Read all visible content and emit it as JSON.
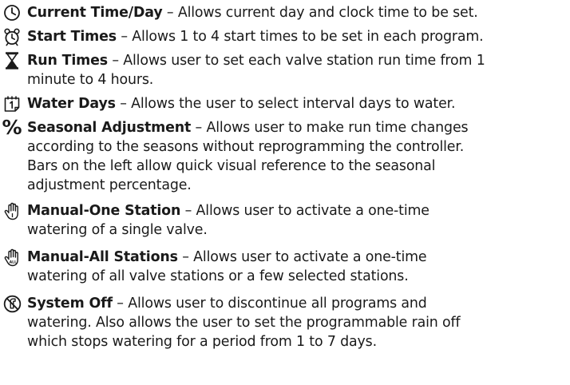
{
  "items": [
    {
      "icon": "clock-icon",
      "title": "Current Time/Day",
      "lines": [
        " – Allows current day and clock time to be set."
      ]
    },
    {
      "icon": "alarm-clock-icon",
      "title": "Start Times",
      "lines": [
        " – Allows 1 to 4 start times to be set in each program."
      ]
    },
    {
      "icon": "hourglass-icon",
      "title": "Run Times",
      "lines": [
        " – Allows user to set each valve station run time from 1",
        "minute to 4 hours."
      ]
    },
    {
      "icon": "calendar-icon",
      "title": "Water Days",
      "lines": [
        " – Allows the user to select interval days to water."
      ]
    },
    {
      "icon": "percent-icon",
      "icon_text": "%",
      "title": "Seasonal Adjustment",
      "lines": [
        " – Allows user to make run time changes",
        "according to the seasons without reprogramming the controller.",
        "Bars on the left allow quick visual reference to the seasonal",
        "adjustment percentage."
      ]
    },
    {
      "icon": "hand-one-icon",
      "title": "Manual-One Station",
      "lines": [
        " – Allows user to activate a one-time",
        "watering of a single valve."
      ]
    },
    {
      "icon": "hand-all-icon",
      "icon_text": "ALL",
      "title": "Manual-All Stations",
      "lines": [
        " – Allows user to activate a one-time",
        "watering of all valve stations or a few selected stations."
      ]
    },
    {
      "icon": "system-off-icon",
      "title": "System Off",
      "lines": [
        " – Allows user to discontinue all programs and",
        "watering. Also allows the user to set the programmable rain off",
        "which stops watering for a period from 1 to 7 days."
      ]
    }
  ]
}
